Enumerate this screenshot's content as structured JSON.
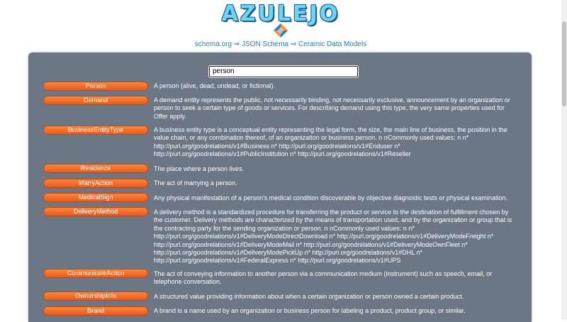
{
  "header": {
    "logo": "AZULEJO",
    "breadcrumb": {
      "item1": "schema.org",
      "arrow1": " ⇒ ",
      "item2": "JSON Schema",
      "arrow2": " ⇒ ",
      "item3": "Ceramic Data Models"
    }
  },
  "search": {
    "value": "person"
  },
  "results": [
    {
      "label": "Person",
      "desc": "A person (alive, dead, undead, or fictional)."
    },
    {
      "label": "Demand",
      "desc": "A demand entity represents the public, not necessarily binding, not necessarily exclusive, announcement by an organization or person to seek a certain type of goods or services. For describing demand using this type, the very same properties used for Offer apply."
    },
    {
      "label": "BusinessEntityType",
      "desc": "A business entity type is a conceptual entity representing the legal form, the size, the main line of business, the position in the value chain, or any combination thereof, of an organization or business person. n nCommonly used values: n n* http://purl.org/goodrelations/v1#Business n* http://purl.org/goodrelations/v1#Enduser n* http://purl.org/goodrelations/v1#PublicInstitution n* http://purl.org/goodrelations/v1#Reseller"
    },
    {
      "label": "Residence",
      "desc": "The place where a person lives."
    },
    {
      "label": "MarryAction",
      "desc": "The act of marrying a person."
    },
    {
      "label": "MedicalSign",
      "desc": "Any physical manifestation of a person's medical condition discoverable by objective diagnostic tests or physical examination."
    },
    {
      "label": "DeliveryMethod",
      "desc": "A delivery method is a standardized procedure for transferring the product or service to the destination of fulfillment chosen by the customer. Delivery methods are characterized by the means of transportation used, and by the organization or group that is the contracting party for the sending organization or person. n nCommonly used values: n n* http://purl.org/goodrelations/v1#DeliveryModeDirectDownload n* http://purl.org/goodrelations/v1#DeliveryModeFreight n* http://purl.org/goodrelations/v1#DeliveryModeMail n* http://purl.org/goodrelations/v1#DeliveryModeOwnFleet n* http://purl.org/goodrelations/v1#DeliveryModePickUp n* http://purl.org/goodrelations/v1#DHL n* http://purl.org/goodrelations/v1#FederalExpress n* http://purl.org/goodrelations/v1#UPS"
    },
    {
      "label": "CommunicateAction",
      "desc": "The act of conveying information to another person via a communication medium (instrument) such as speech, email, or telephone conversation."
    },
    {
      "label": "OwnershipInfo",
      "desc": "A structured value providing information about when a certain organization or person owned a certain product."
    },
    {
      "label": "Brand",
      "desc": "A brand is a name used by an organization or business person for labeling a product, product group, or similar."
    }
  ],
  "colors": {
    "accent": "#e8561a",
    "panel": "#6b7785",
    "link": "#2b7bbf"
  },
  "icons": {
    "logo_mark": "diamond-tile-icon"
  }
}
